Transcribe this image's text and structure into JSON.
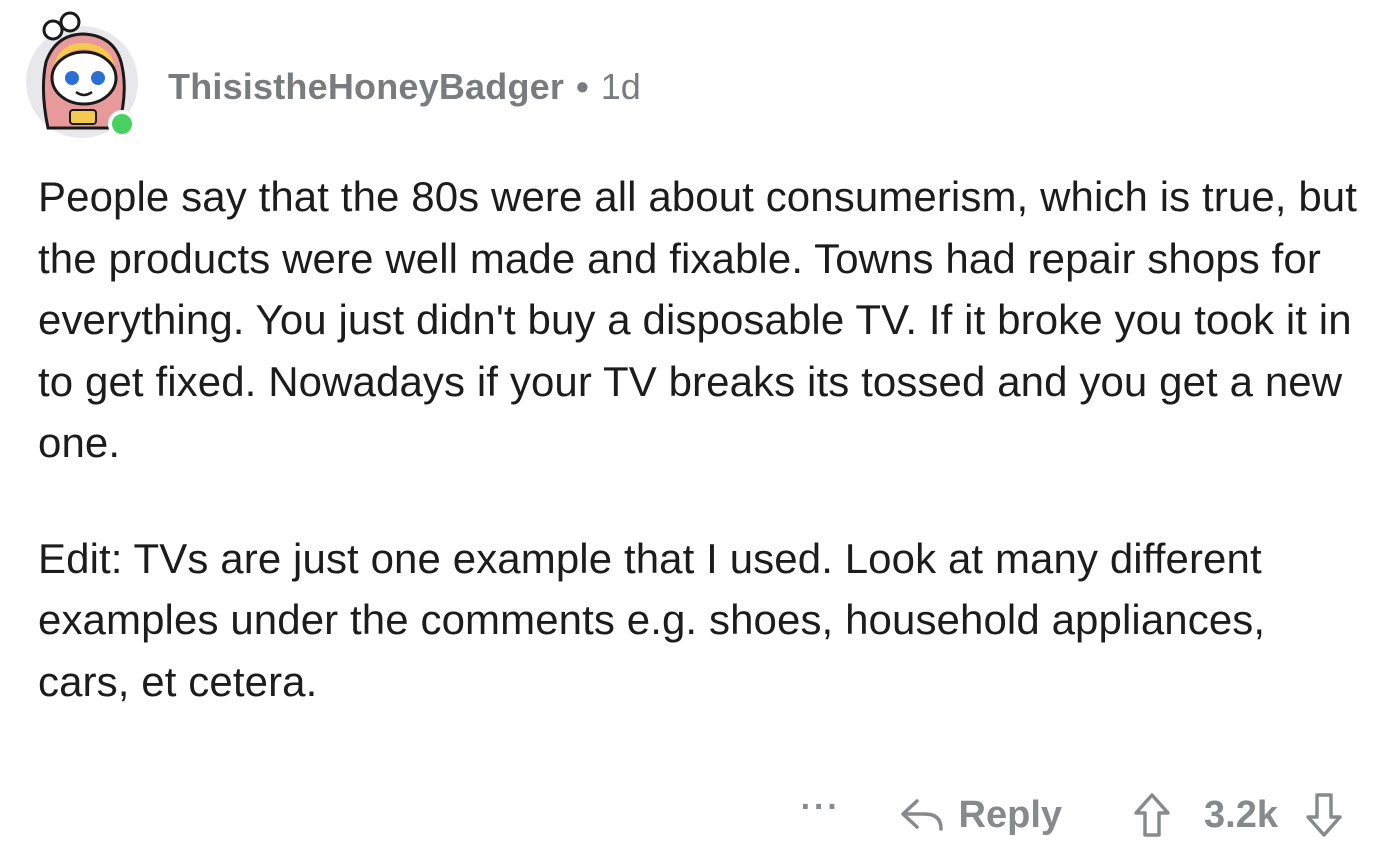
{
  "comment": {
    "author": "ThisistheHoneyBadger",
    "separator": "•",
    "age": "1d",
    "body_paragraphs": [
      "People say that the 80s were all about consumerism, which is true, but the products were well made and fixable. Towns had repair shops for everything. You just didn't buy a disposable TV. If it broke you took it in to get fixed. Nowadays if your TV breaks its tossed and you get a new one.",
      "Edit: TVs are just one example that I used.  Look at many different examples under the comments e.g. shoes, household appliances, cars, et cetera."
    ],
    "online": true
  },
  "actions": {
    "more_label": "···",
    "reply_label": "Reply",
    "score": "3.2k",
    "icons": {
      "more": "more-dots-icon",
      "reply": "reply-arrow-icon",
      "upvote": "upvote-arrow-icon",
      "downvote": "downvote-arrow-icon"
    }
  },
  "colors": {
    "online_dot": "#46d160",
    "meta_text": "#787c7e",
    "body_text": "#1c1c1c",
    "action_text": "#878a8c",
    "avatar_bg": "#e8e8ec",
    "avatar_hood": "#e89a9a"
  }
}
